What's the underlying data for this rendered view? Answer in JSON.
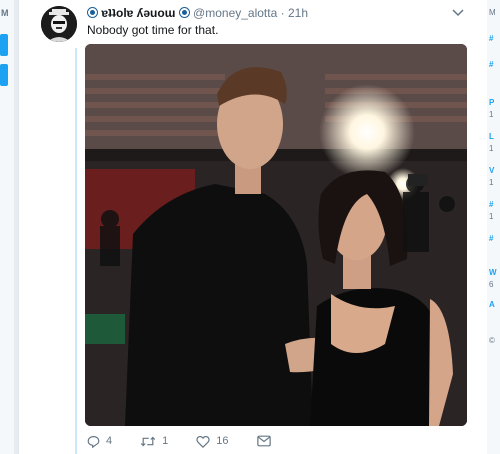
{
  "left_gutter": {
    "letter": "M"
  },
  "tweet": {
    "display_name": "ɐʇʇolɐ ʎǝuoɯ",
    "handle": "@money_alotta",
    "separator": "·",
    "timestamp": "21h",
    "text": "Nobody got time for that.",
    "actions": {
      "reply_count": "4",
      "retweet_count": "1",
      "like_count": "16"
    }
  },
  "right_gutter": {
    "letters": [
      "M",
      "#",
      "#",
      "P",
      "1",
      "L",
      "1",
      "V",
      "1",
      "#",
      "1",
      "#",
      "W",
      "6",
      "A",
      "©"
    ]
  },
  "colors": {
    "accent": "#1da1f2",
    "muted_text": "#657786",
    "thread_line": "#cce7f7"
  },
  "icons": [
    "reply-icon",
    "retweet-icon",
    "like-icon",
    "direct-message-icon",
    "chevron-down-icon"
  ]
}
